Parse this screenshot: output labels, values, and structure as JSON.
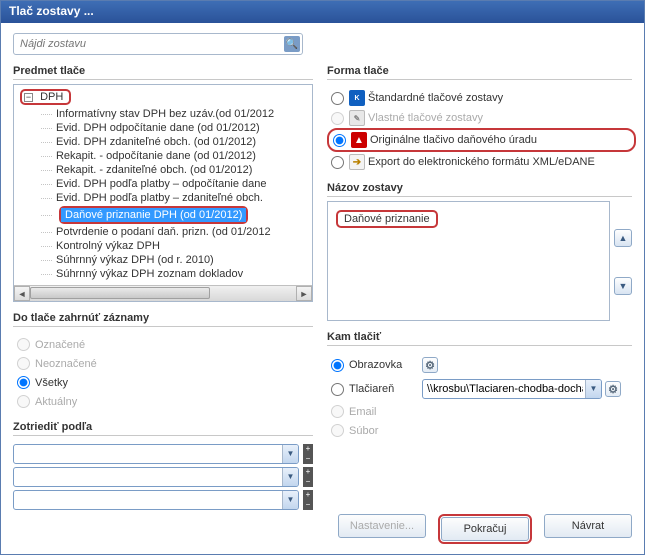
{
  "window": {
    "title": "Tlač zostavy ..."
  },
  "search": {
    "placeholder": "Nájdi zostavu"
  },
  "sections": {
    "predmet": "Predmet tlače",
    "forma": "Forma tlače",
    "nazov": "Názov zostavy",
    "zahrnut": "Do tlače zahrnúť záznamy",
    "kam": "Kam tlačiť",
    "sort": "Zotriediť podľa"
  },
  "tree": {
    "root": "DPH",
    "items": [
      "Informatívny stav DPH bez uzáv.(od 01/2012",
      "Evid. DPH odpočítanie dane (od 01/2012)",
      "Evid. DPH zdaniteľné obch. (od 01/2012)",
      "Rekapit. - odpočítanie dane (od 01/2012)",
      "Rekapit. - zdaniteľné obch. (od 01/2012)",
      "Evid. DPH podľa platby – odpočítanie dane",
      "Evid. DPH podľa platby – zdaniteľné obch.",
      "Daňové priznanie DPH (od 01/2012)",
      "Potvrdenie o podaní daň. prizn. (od 01/2012",
      "Kontrolný výkaz DPH",
      "Súhrnný výkaz DPH (od r. 2010)",
      "Súhrnný výkaz DPH zoznam dokladov"
    ],
    "selected_index": 7
  },
  "forma_options": {
    "standard": "Štandardné tlačové zostavy",
    "vlastne": "Vlastné tlačové zostavy",
    "original": "Originálne tlačivo daňového úradu",
    "export": "Export do elektronického formátu XML/eDANE"
  },
  "nazov_value": "Daňové priznanie",
  "zahrnut_options": {
    "oznacene": "Označené",
    "neoznacene": "Neoznačené",
    "vsetky": "Všetky",
    "aktualny": "Aktuálny"
  },
  "kam_options": {
    "obrazovka": "Obrazovka",
    "tlaciaren": "Tlačiareň",
    "email": "Email",
    "subor": "Súbor"
  },
  "printer": {
    "value": "\\\\krosbu\\Tlaciaren-chodba-dochadzk..."
  },
  "buttons": {
    "nastavenie": "Nastavenie...",
    "pokracuj": "Pokračuj",
    "navrat": "Návrat"
  },
  "colors": {
    "highlight": "#c6373a",
    "select_bg": "#3399ff"
  }
}
